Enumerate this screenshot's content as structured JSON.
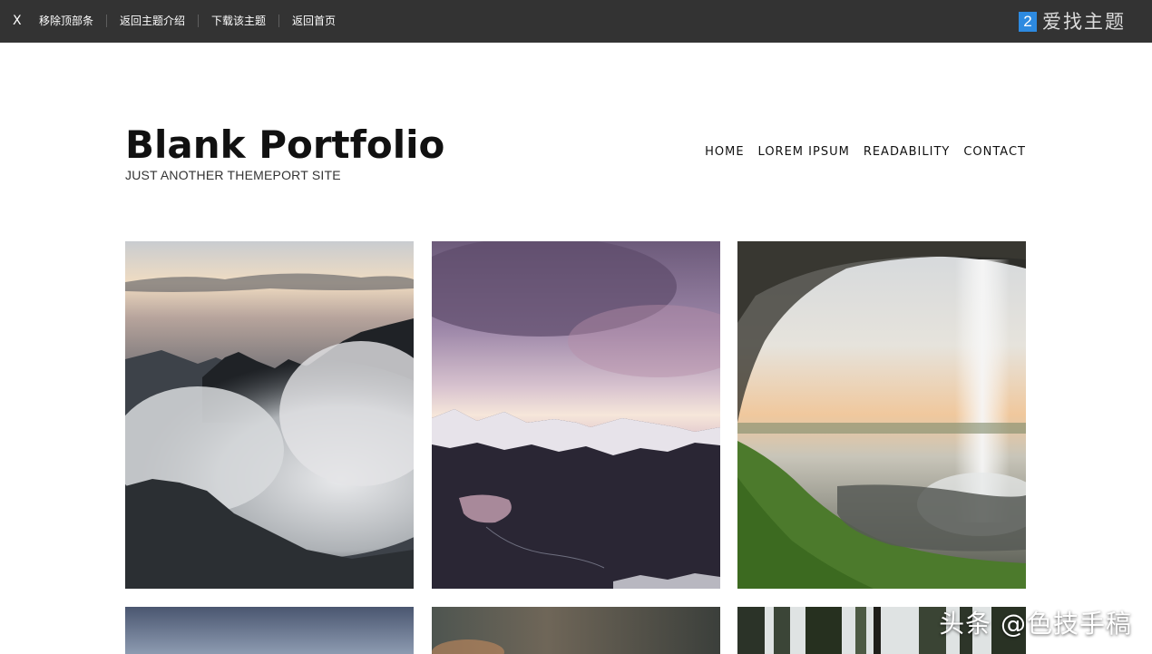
{
  "topbar": {
    "close_label": "X",
    "links": [
      "移除顶部条",
      "返回主题介绍",
      "下载该主题",
      "返回首页"
    ],
    "brand_badge": "2",
    "brand_text": "爱找主题",
    "brand_color": "#2d8ae0"
  },
  "site": {
    "title": "Blank Portfolio",
    "tagline": "JUST ANOTHER THEMEPORT SITE"
  },
  "nav": [
    "HOME",
    "LOREM IPSUM",
    "READABILITY",
    "CONTACT"
  ],
  "gallery": [
    {
      "subject": "cloudy-mountains-photo"
    },
    {
      "subject": "snowy-mountain-lake-photo"
    },
    {
      "subject": "cave-waterfall-photo"
    },
    {
      "subject": "blue-sky-photo"
    },
    {
      "subject": "sunset-landscape-photo"
    },
    {
      "subject": "forest-trees-photo"
    }
  ],
  "watermark": "头条 @色技手稿"
}
